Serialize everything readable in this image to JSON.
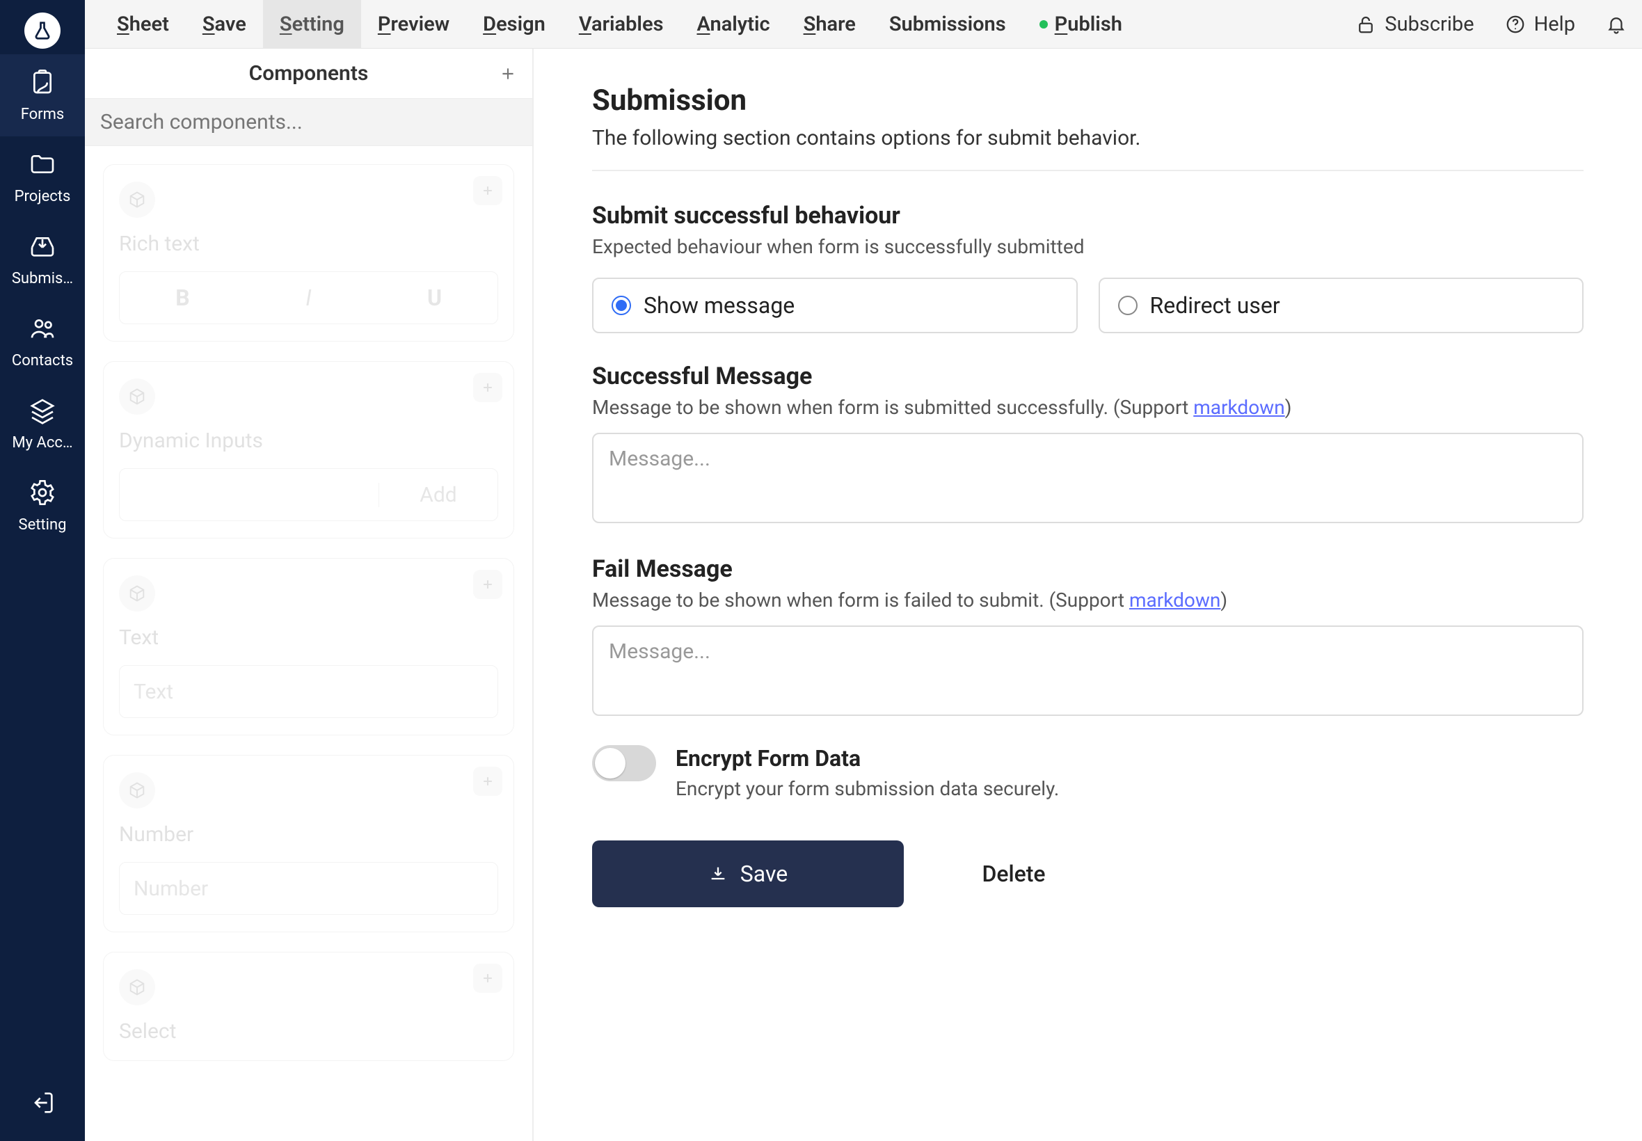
{
  "sidebar": {
    "items": [
      {
        "label": "Forms"
      },
      {
        "label": "Projects"
      },
      {
        "label": "Submis…"
      },
      {
        "label": "Contacts"
      },
      {
        "label": "My Acc…"
      },
      {
        "label": "Setting"
      }
    ]
  },
  "toolbar": {
    "tabs": [
      {
        "first": "S",
        "rest": "heet"
      },
      {
        "first": "S",
        "rest": "ave"
      },
      {
        "first": "S",
        "rest": "etting"
      },
      {
        "first": "P",
        "rest": "review"
      },
      {
        "first": "D",
        "rest": "esign"
      },
      {
        "first": "V",
        "rest": "ariables"
      },
      {
        "first": "A",
        "rest": "nalytic"
      },
      {
        "first": "S",
        "rest": "hare"
      },
      {
        "first": "",
        "rest": "Submissions"
      },
      {
        "first": "P",
        "rest": "ublish"
      }
    ],
    "subscribe": "Subscribe",
    "help": "Help"
  },
  "components_panel": {
    "title": "Components",
    "search_placeholder": "Search components...",
    "items": [
      {
        "name": "Rich text",
        "type": "biu"
      },
      {
        "name": "Dynamic Inputs",
        "type": "dyn",
        "add": "Add"
      },
      {
        "name": "Text",
        "type": "ph",
        "ph": "Text"
      },
      {
        "name": "Number",
        "type": "ph",
        "ph": "Number"
      },
      {
        "name": "Select",
        "type": "none"
      }
    ]
  },
  "content": {
    "title": "Submission",
    "subtitle": "The following section contains options for submit behavior.",
    "behaviour_title": "Submit successful behaviour",
    "behaviour_desc": "Expected behaviour when form is successfully submitted",
    "radio_show": "Show message",
    "radio_redirect": "Redirect user",
    "success_title": "Successful Message",
    "success_desc_pre": "Message to be shown when form is submitted successfully. (Support ",
    "success_desc_link": "markdown",
    "success_desc_post": ")",
    "fail_title": "Fail Message",
    "fail_desc_pre": "Message to be shown when form is failed to submit. (Support ",
    "fail_desc_link": "markdown",
    "fail_desc_post": ")",
    "msg_placeholder": "Message...",
    "encrypt_title": "Encrypt Form Data",
    "encrypt_desc": "Encrypt your form submission data securely.",
    "save": "Save",
    "delete": "Delete"
  }
}
